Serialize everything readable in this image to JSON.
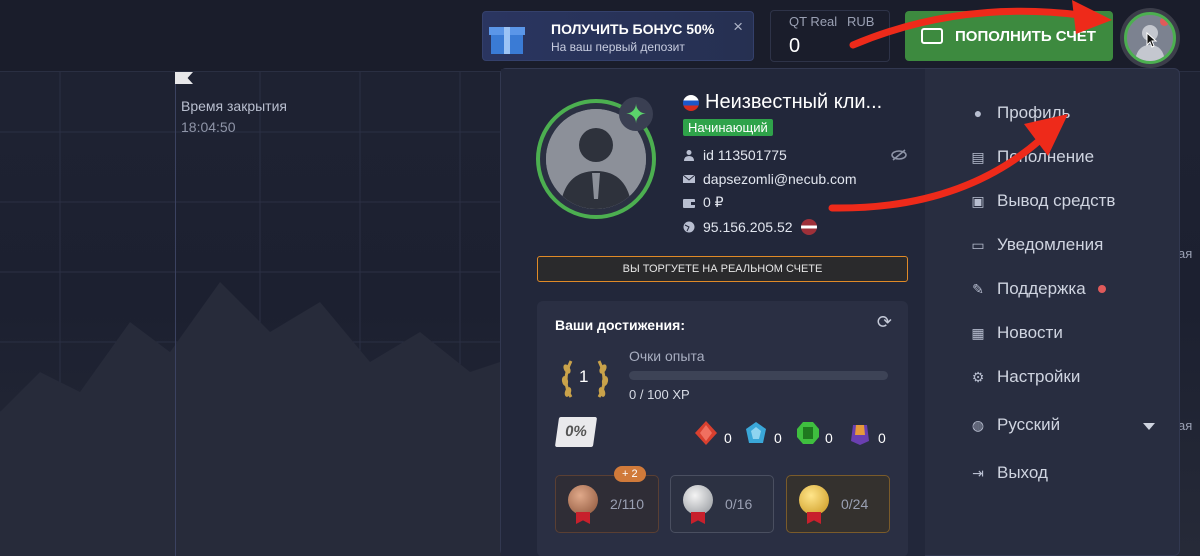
{
  "chart": {
    "close_label": "Время закрытия",
    "close_time": "18:04:50",
    "side_texts": [
      "ая",
      "ая"
    ]
  },
  "header": {
    "bonus": {
      "title": "ПОЛУЧИТЬ БОНУС 50%",
      "subtitle": "На ваш первый депозит",
      "close": "×"
    },
    "balance": {
      "mode": "QT Real",
      "currency": "RUB",
      "value": "0"
    },
    "deposit_label": "ПОПОЛНИТЬ СЧЁТ"
  },
  "profile": {
    "name": "Неизвестный кли...",
    "level_badge": "Начинающий",
    "id": "id 113501775",
    "email": "dapsezomli@necub.com",
    "balance": "0 ₽",
    "ip": "95.156.205.52",
    "real_notice": "ВЫ ТОРГУЕТЕ НА РЕАЛЬНОМ СЧЕТЕ"
  },
  "achievements": {
    "title": "Ваши достижения:",
    "level": "1",
    "xp_label": "Очки опыта",
    "xp_value": "0 / 100 XP",
    "xp_progress": 0,
    "discount": "0%",
    "gems": [
      {
        "name": "red-gem-icon",
        "value": "0",
        "color": "#d8402f"
      },
      {
        "name": "blue-gem-icon",
        "value": "0",
        "color": "#3aa7d8"
      },
      {
        "name": "green-gem-icon",
        "value": "0",
        "color": "#3fbf3f"
      },
      {
        "name": "purple-gem-icon",
        "value": "0",
        "color": "#6a3fb0"
      }
    ],
    "medals": [
      {
        "value": "2/110",
        "badge": "+ 2"
      },
      {
        "value": "0/16"
      },
      {
        "value": "0/24"
      }
    ]
  },
  "menu": {
    "items": [
      {
        "label": "Профиль"
      },
      {
        "label": "Пополнение"
      },
      {
        "label": "Вывод средств"
      },
      {
        "label": "Уведомления"
      },
      {
        "label": "Поддержка"
      },
      {
        "label": "Новости"
      },
      {
        "label": "Настройки"
      },
      {
        "label": "Русский"
      },
      {
        "label": "Выход"
      }
    ]
  },
  "colors": {
    "accent_green": "#4caf50",
    "deposit_green": "#3d8a3f",
    "notice_border": "#e08a27",
    "annotation_red": "#ee2a1a"
  }
}
